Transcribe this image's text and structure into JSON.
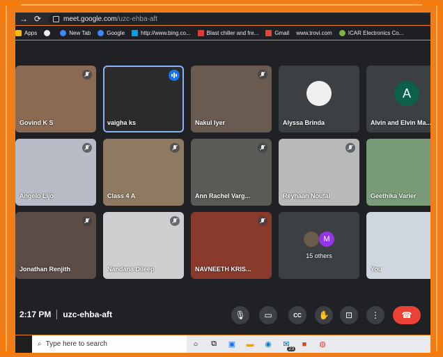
{
  "browser": {
    "url_host": "meet.google.com",
    "url_path": "/uzc-ehba-aft"
  },
  "bookmarks": [
    {
      "label": "Apps",
      "icon": "apps-grid-icon",
      "color": "#fbbc04"
    },
    {
      "label": "",
      "icon": "globe-icon",
      "color": "#e8eaed"
    },
    {
      "label": "New Tab",
      "icon": "google-icon",
      "color": "#4285f4"
    },
    {
      "label": "Google",
      "icon": "google-icon",
      "color": "#4285f4"
    },
    {
      "label": "http://www.bing.co...",
      "icon": "bing-icon",
      "color": "#00a1f1"
    },
    {
      "label": "Blast chiller and fre...",
      "icon": "bookmark-icon",
      "color": "#e53935"
    },
    {
      "label": "Gmail",
      "icon": "gmail-icon",
      "color": "#ea4335"
    },
    {
      "label": "www.trovi.com",
      "icon": "",
      "color": ""
    },
    {
      "label": "ICAR Electronics Co...",
      "icon": "plant-icon",
      "color": "#7cb342"
    }
  ],
  "participants": [
    {
      "name": "Govind K S",
      "bg": "#8a6a52",
      "mic": "off"
    },
    {
      "name": "vaigha ks",
      "bg": "#2b2b2b",
      "mic": "speaking"
    },
    {
      "name": "Nakul Iyer",
      "bg": "#6a5b50",
      "mic": "off"
    },
    {
      "name": "Alyssa Brinda",
      "bg": "#3c4043",
      "mic": "none",
      "avatar_bg": "#f0f0f0"
    },
    {
      "name": "Alvin and Elvin Ma...",
      "bg": "#3c4043",
      "mic": "off",
      "avatar_letter": "A",
      "avatar_bg": "#0b5f4b"
    },
    {
      "name": "Angelo Lijo",
      "bg": "#b8bcc6",
      "mic": "off"
    },
    {
      "name": "Class 4 A",
      "bg": "#8e7a60",
      "mic": "off"
    },
    {
      "name": "Ann Rachel Varg...",
      "bg": "#5c5a57",
      "mic": "off"
    },
    {
      "name": "Reyhaan Noufal",
      "bg": "#b7bab8",
      "mic": "off"
    },
    {
      "name": "Geethika Varier",
      "bg": "#7a9b78",
      "mic": "off"
    },
    {
      "name": "Jonathan Renjith",
      "bg": "#5b4c46",
      "mic": "off"
    },
    {
      "name": "Nandana Dileep",
      "bg": "#cfcfd2",
      "mic": "off"
    },
    {
      "name": "NAVNEETH KRIS...",
      "bg": "#8a3a2a",
      "mic": "off"
    },
    {
      "name": "15 others",
      "bg": "#3c4043",
      "mic": "none",
      "avatar_letter": "M",
      "avatar_bg": "#9334e6"
    },
    {
      "name": "You",
      "bg": "#cfd6df",
      "mic": "none"
    }
  ],
  "meeting": {
    "time": "2:17 PM",
    "code": "uzc-ehba-aft"
  },
  "controls": [
    {
      "name": "microphone-button",
      "icon": "microphone-icon"
    },
    {
      "name": "camera-button",
      "icon": "camera-icon"
    },
    {
      "name": "captions-button",
      "icon": "captions-icon",
      "label": "CC"
    },
    {
      "name": "raise-hand-button",
      "icon": "hand-icon"
    },
    {
      "name": "present-button",
      "icon": "present-icon"
    },
    {
      "name": "more-options-button",
      "icon": "more-vert-icon"
    },
    {
      "name": "end-call-button",
      "icon": "phone-hangup-icon"
    }
  ],
  "taskbar": {
    "search_placeholder": "Type here to search",
    "mail_badge": "23"
  }
}
